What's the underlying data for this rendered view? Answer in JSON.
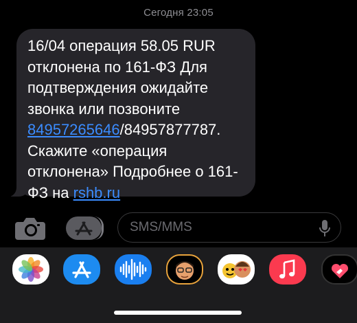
{
  "timestamp": "Сегодня 23:05",
  "message": {
    "before_link1": "16/04 операция 58.05 RUR отклонена по 161-ФЗ Для подтверждения ожидайте звонка или позвоните ",
    "link1": "84957265646",
    "between": "/84957877787. Скажите «операция отклонена» Подробнее о 161-ФЗ на ",
    "link2": "rshb.ru",
    "link_color": "#3b8cff"
  },
  "composer": {
    "placeholder": "SMS/MMS",
    "camera_icon": "camera-icon",
    "appstore_icon": "app-store-icon",
    "mic_icon": "microphone-icon"
  },
  "app_drawer": {
    "apps": [
      {
        "name": "photos",
        "icon": "photos-icon"
      },
      {
        "name": "app-store",
        "icon": "app-store-icon"
      },
      {
        "name": "audio-message",
        "icon": "waveform-icon"
      },
      {
        "name": "memoji",
        "icon": "memoji-icon"
      },
      {
        "name": "memoji-stickers",
        "icon": "memoji-sticker-icon"
      },
      {
        "name": "music",
        "icon": "music-note-icon"
      },
      {
        "name": "digital-touch",
        "icon": "heart-hand-icon"
      }
    ]
  }
}
